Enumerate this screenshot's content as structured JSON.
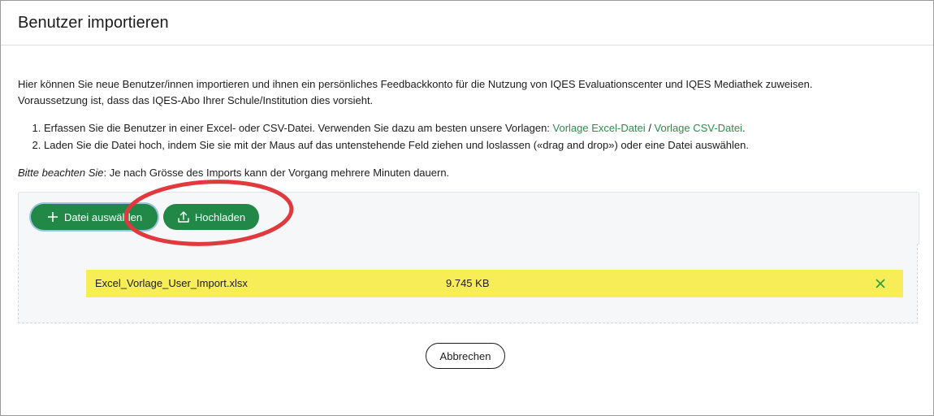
{
  "dialog": {
    "title": "Benutzer importieren"
  },
  "intro": {
    "line1": "Hier können Sie neue Benutzer/innen importieren und ihnen ein persönliches Feedbackkonto für die Nutzung von IQES Evaluationscenter und IQES Mediathek zuweisen.",
    "line2": "Voraussetzung ist, dass das IQES-Abo Ihrer Schule/Institution dies vorsieht."
  },
  "steps": {
    "step1_text": "Erfassen Sie die Benutzer in einer Excel- oder CSV-Datei. Verwenden Sie dazu am besten unsere Vorlagen: ",
    "step1_link_excel": "Vorlage Excel-Datei",
    "step1_separator": " / ",
    "step1_link_csv": "Vorlage CSV-Datei",
    "step1_end": ".",
    "step2_text": "Laden Sie die Datei hoch, indem Sie sie mit der Maus auf das untenstehende Feld ziehen und loslassen («drag and drop») oder eine Datei auswählen."
  },
  "note": {
    "label": "Bitte beachten Sie",
    "text": ": Je nach Grösse des Imports kann der Vorgang mehrere Minuten dauern."
  },
  "toolbar": {
    "select_label": "Datei auswählen",
    "select_icon": "plus-icon",
    "upload_label": "Hochladen",
    "upload_icon": "upload-icon"
  },
  "file": {
    "name": "Excel_Vorlage_User_Import.xlsx",
    "size": "9.745 KB",
    "remove_icon": "close-icon"
  },
  "footer": {
    "cancel_label": "Abbrechen"
  },
  "colors": {
    "primary_green": "#228848",
    "link_green": "#2e8b4b",
    "file_highlight": "#f7ee57",
    "annotation_red": "#e0393e"
  }
}
